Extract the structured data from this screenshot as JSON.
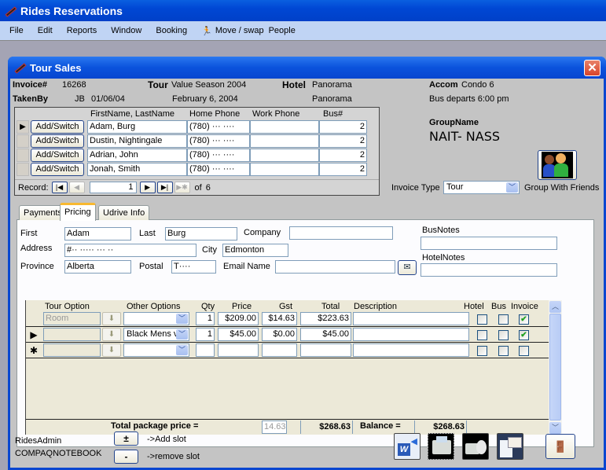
{
  "app": {
    "title": "Rides Reservations",
    "menu": [
      "File",
      "Edit",
      "Reports",
      "Window",
      "Booking",
      "Move / swap",
      "People"
    ]
  },
  "window": {
    "title": "Tour Sales",
    "close_label": "✕"
  },
  "header": {
    "invoice_label": "Invoice#",
    "invoice_value": "16268",
    "tour_label": "Tour",
    "tour_value": "Value Season 2004",
    "hotel_label": "Hotel",
    "hotel_value": "Panorama",
    "hotel_value2": "Panorama",
    "accom_label": "Accom",
    "accom_value": "Condo 6",
    "bus_departs": "Bus departs 6:00 pm",
    "takenby_label": "TakenBy",
    "takenby_initials": "JB",
    "takenby_date": "01/06/04",
    "tour_date": "February 6, 2004",
    "groupname_label": "GroupName",
    "groupname_value": "NAIT- NASS",
    "invoice_type_label": "Invoice Type",
    "invoice_type_value": "Tour",
    "group_friends_label": "Group With Friends"
  },
  "people_grid": {
    "columns": [
      "FirstName, LastName",
      "Home Phone",
      "Work Phone",
      "Bus#"
    ],
    "button_label": "Add/Switch",
    "rows": [
      {
        "name": "Adam, Burg",
        "home_phone": "(780) ··· ····",
        "work_phone": "",
        "bus": "2",
        "current": true
      },
      {
        "name": "Dustin, Nightingale",
        "home_phone": "(780) ··· ····",
        "work_phone": "",
        "bus": "2",
        "current": false
      },
      {
        "name": "Adrian, John",
        "home_phone": "(780) ··· ····",
        "work_phone": "",
        "bus": "2",
        "current": false
      },
      {
        "name": "Jonah, Smith",
        "home_phone": "(780) ··· ····",
        "work_phone": "",
        "bus": "2",
        "current": false
      }
    ],
    "nav": {
      "record_label": "Record:",
      "current": "1",
      "of_label": "of",
      "total": "6"
    }
  },
  "tabs": [
    "Payments",
    "Pricing",
    "Udrive Info"
  ],
  "active_tab": "Pricing",
  "pricing": {
    "first_label": "First",
    "first_value": "Adam",
    "last_label": "Last",
    "last_value": "Burg",
    "company_label": "Company",
    "company_value": "",
    "address_label": "Address",
    "address_value": "#·· ····· ··· ··",
    "city_label": "City",
    "city_value": "Edmonton",
    "province_label": "Province",
    "province_value": "Alberta",
    "postal_label": "Postal",
    "postal_value": "T····",
    "email_label": "Email Name",
    "email_value": "",
    "busnotes_label": "BusNotes",
    "busnotes_value": "",
    "hotelnotes_label": "HotelNotes",
    "hotelnotes_value": ""
  },
  "options_grid": {
    "columns": [
      "Tour Option",
      "Other Options",
      "Qty",
      "Price",
      "Gst",
      "Total",
      "Description",
      "Hotel",
      "Bus",
      "Invoice"
    ],
    "rows": [
      {
        "selector": "",
        "tour_option": "Room",
        "other_option": "",
        "qty": "1",
        "price": "$209.00",
        "gst": "$14.63",
        "total": "$223.63",
        "description": "",
        "hotel": false,
        "bus": false,
        "invoice": true
      },
      {
        "selector": "▶",
        "tour_option": "",
        "other_option": "Black Mens v",
        "qty": "1",
        "price": "$45.00",
        "gst": "$0.00",
        "total": "$45.00",
        "description": "",
        "hotel": false,
        "bus": false,
        "invoice": true
      },
      {
        "selector": "✱",
        "tour_option": "",
        "other_option": "",
        "qty": "",
        "price": "",
        "gst": "",
        "total": "",
        "description": "",
        "hotel": false,
        "bus": false,
        "invoice": false
      }
    ],
    "totals": {
      "label": "Total package price =",
      "gst_total": "14.63",
      "package_total": "$268.63",
      "balance_label": "Balance =",
      "balance_value": "$268.63"
    }
  },
  "footer": {
    "user": "RidesAdmin",
    "machine": "COMPAQNOTEBOOK",
    "add_slot_button": "±",
    "add_slot_label": "->Add slot",
    "remove_slot_button": "-",
    "remove_slot_label": "->remove slot"
  },
  "colors": {
    "titlebar": "#0047d4",
    "menubar": "#c0d4f4",
    "close_button": "#d8442a",
    "tab_highlight": "#f8b830",
    "check_green": "#21a121"
  }
}
